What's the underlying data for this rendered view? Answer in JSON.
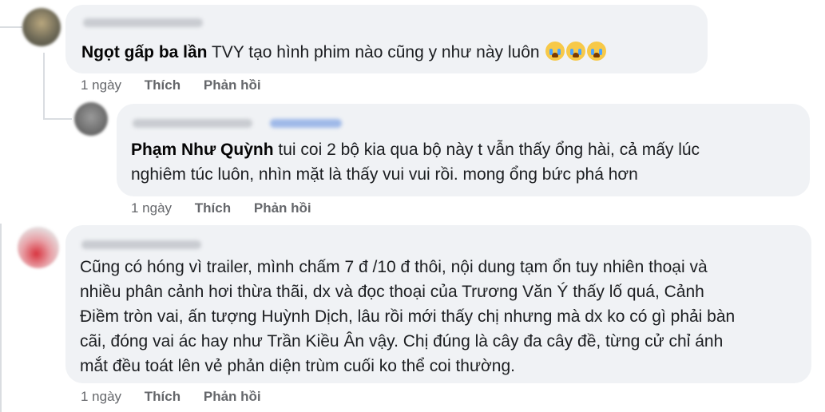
{
  "comments": [
    {
      "name_part": "Ngọt gấp ba lần",
      "text": " TVY tạo hình phim nào cũng y như này luôn",
      "emoji": [
        "crying-face-emoji",
        "crying-face-emoji",
        "crying-face-emoji"
      ],
      "time": "1 ngày",
      "like": "Thích",
      "reply": "Phản hồi"
    },
    {
      "tag": "Phạm Như Quỳnh",
      "line1": " tui coi 2 bộ kia qua bộ này t vẫn thấy ổng hài, cả mấy lúc",
      "line2": "nghiêm túc luôn, nhìn mặt là thấy vui vui rồi. mong ổng bức phá hơn",
      "time": "1 ngày",
      "like": "Thích",
      "reply": "Phản hồi"
    },
    {
      "lines": [
        "Cũng có hóng vì trailer, mình chấm 7 đ /10 đ thôi, nội dung tạm ổn tuy nhiên thoại và",
        "nhiều phân cảnh hơi thừa thãi, dx và đọc thoại của Trương Văn Ý thấy lố quá, Cảnh",
        "Điềm tròn vai, ấn tượng Huỳnh Dịch, lâu rồi mới thấy chị nhưng mà dx ko có gì phải bàn",
        "cãi, đóng vai ác hay như Trần Kiều Ân vậy. Chị đúng là cây đa cây đề, từng cử chỉ ánh",
        "mắt đều toát lên vẻ phản diện trùm cuối ko thể coi thường."
      ],
      "time": "1 ngày",
      "like": "Thích",
      "reply": "Phản hồi"
    }
  ]
}
